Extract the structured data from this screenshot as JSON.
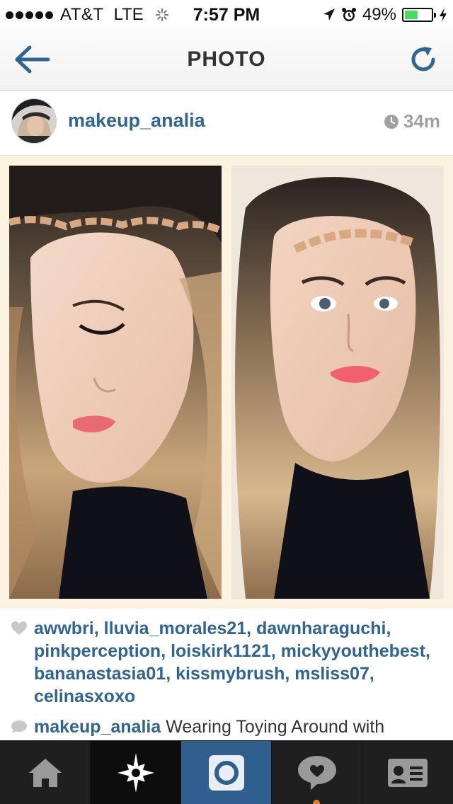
{
  "status_bar": {
    "carrier": "AT&T",
    "network": "LTE",
    "time": "7:57 PM",
    "battery_percent": "49%",
    "battery_level": 0.49,
    "icons": [
      "signal-dots-icon",
      "activity-spinner-icon",
      "location-arrow-icon",
      "alarm-icon",
      "battery-icon",
      "charging-bolt-icon"
    ]
  },
  "nav": {
    "title": "PHOTO",
    "back_icon": "back-arrow-icon",
    "refresh_icon": "refresh-icon"
  },
  "post": {
    "username": "makeup_analia",
    "time_ago": "34m",
    "time_icon": "clock-icon"
  },
  "likes": {
    "names": [
      "awwbri",
      "lluvia_morales21",
      "dawnharaguchi",
      "pinkperception",
      "loiskirk1121",
      "mickyyouthebest",
      "bananastasia01",
      "kissmybrush",
      "msliss07",
      "celinasxoxo"
    ],
    "icon": "heart-icon"
  },
  "caption": {
    "user": "makeup_analia",
    "text": "Wearing Toying Around with",
    "icon": "comment-bubble-icon"
  },
  "tabbar": {
    "tabs": [
      "home-icon",
      "explore-star-icon",
      "camera-icon",
      "activity-heart-bubble-icon",
      "profile-card-icon"
    ],
    "active": "camera-icon"
  },
  "colors": {
    "link_blue": "#2e6592",
    "photo_frame": "#fbf3df",
    "tabbar_bg": "#1f1f1f",
    "tab_active": "#2f5f8c",
    "battery_green": "#4cd964"
  }
}
